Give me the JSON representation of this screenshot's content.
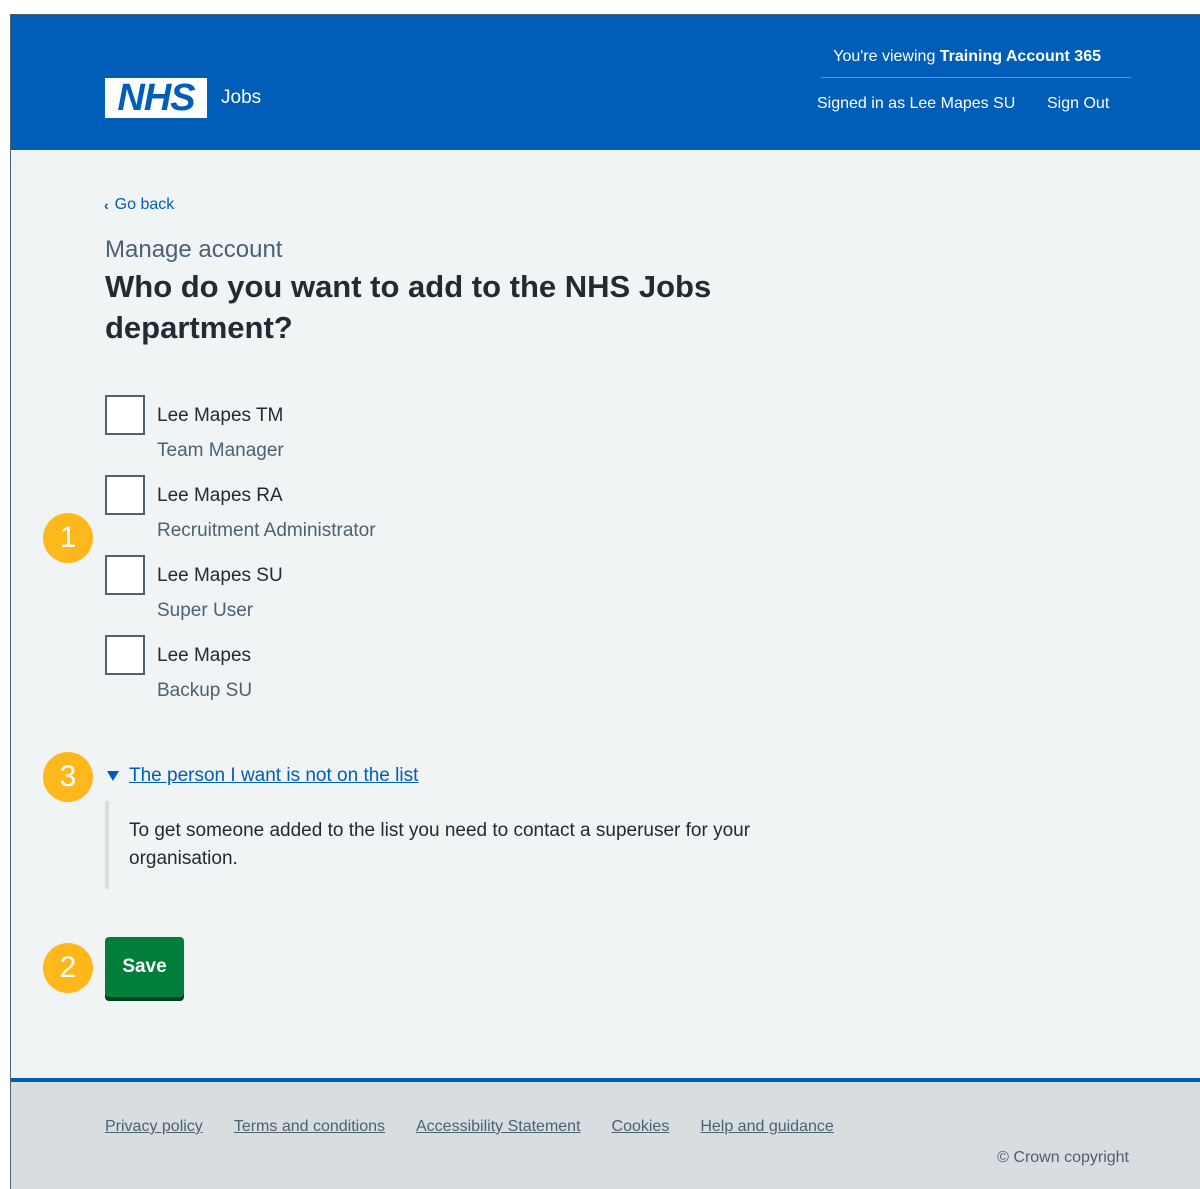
{
  "header": {
    "logo_text": "NHS",
    "service_name": "Jobs",
    "viewing_prefix": "You're viewing ",
    "viewing_account": "Training Account 365",
    "signed_in": "Signed in as Lee Mapes SU",
    "sign_out": "Sign Out"
  },
  "main": {
    "back_link": "Go back",
    "caption": "Manage account",
    "title": "Who do you want to add to the NHS Jobs department?",
    "users": [
      {
        "name": "Lee Mapes TM",
        "role": "Team Manager"
      },
      {
        "name": "Lee Mapes RA",
        "role": "Recruitment Administrator"
      },
      {
        "name": "Lee Mapes SU",
        "role": "Super User"
      },
      {
        "name": "Lee Mapes",
        "role": "Backup SU"
      }
    ],
    "details": {
      "summary": "The person I want is not on the list",
      "body": "To get someone added to the list you need to contact a superuser for your organisation."
    },
    "save_label": "Save"
  },
  "markers": [
    "1",
    "2",
    "3"
  ],
  "footer": {
    "links": [
      "Privacy policy",
      "Terms and conditions",
      "Accessibility Statement",
      "Cookies",
      "Help and guidance"
    ],
    "copyright": "© Crown copyright"
  },
  "colors": {
    "nhs_blue": "#005eb8",
    "button_green": "#007f3b",
    "marker_yellow": "#ffb81c",
    "page_background": "#f0f4f5"
  }
}
